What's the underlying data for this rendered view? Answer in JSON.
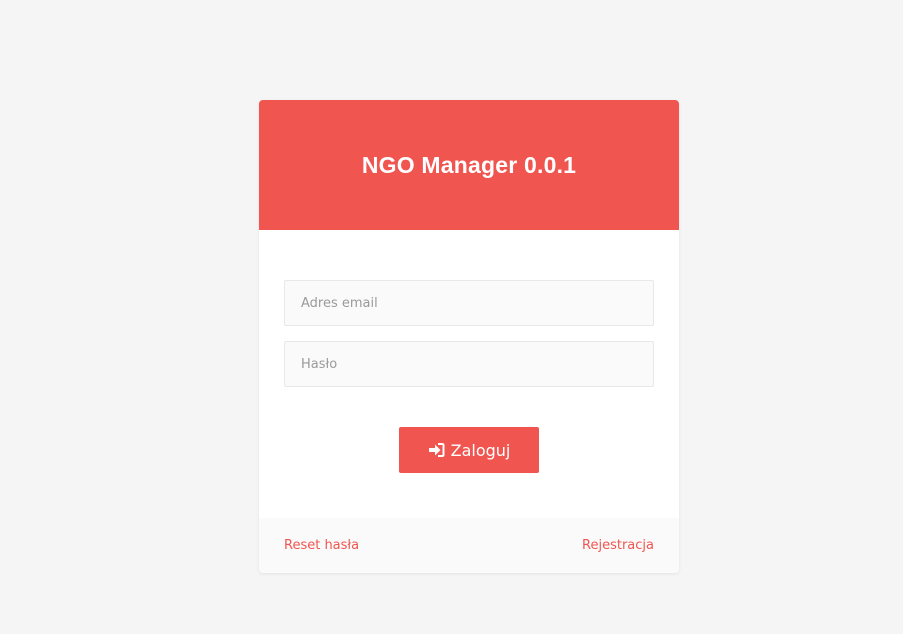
{
  "app": {
    "title": "NGO Manager 0.0.1"
  },
  "form": {
    "email_placeholder": "Adres email",
    "email_value": "",
    "password_placeholder": "Hasło",
    "password_value": "",
    "login_label": "Zaloguj",
    "login_icon": "sign-in-icon"
  },
  "footer": {
    "reset_label": "Reset hasła",
    "register_label": "Rejestracja"
  },
  "colors": {
    "accent": "#f05550",
    "background": "#f5f5f5",
    "card": "#ffffff",
    "input_bg": "#fafafa"
  }
}
